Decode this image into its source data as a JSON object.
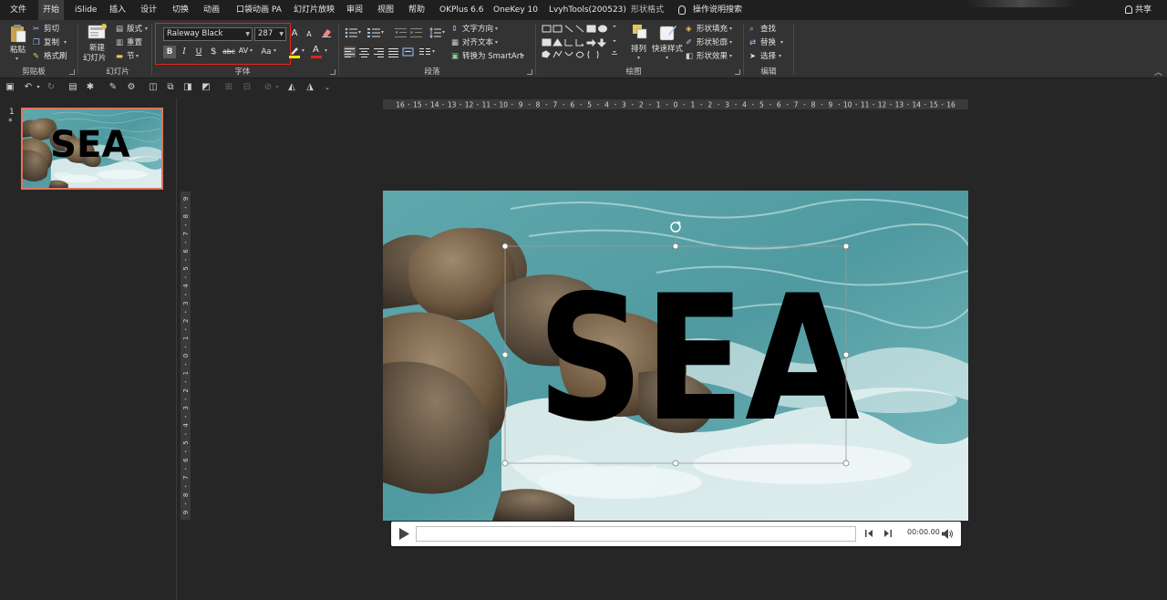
{
  "menu": {
    "tabs": [
      {
        "label": "文件"
      },
      {
        "label": "开始"
      },
      {
        "label": "iSlide"
      },
      {
        "label": "插入"
      },
      {
        "label": "设计"
      },
      {
        "label": "切换"
      },
      {
        "label": "动画"
      },
      {
        "label": "口袋动画 PA"
      },
      {
        "label": "幻灯片放映"
      },
      {
        "label": "审阅"
      },
      {
        "label": "视图"
      },
      {
        "label": "帮助"
      },
      {
        "label": "OKPlus 6.6"
      },
      {
        "label": "OneKey 10"
      },
      {
        "label": "LvyhTools(200523)"
      },
      {
        "label": "形状格式"
      }
    ],
    "active_tab": "开始",
    "search_label": "操作说明搜索",
    "share_label": "共享"
  },
  "ribbon": {
    "clipboard": {
      "paste": "粘贴",
      "cut": "剪切",
      "copy": "复制",
      "format_painter": "格式刷",
      "group_label": "剪贴板"
    },
    "slides": {
      "new_slide_line1": "新建",
      "new_slide_line2": "幻灯片",
      "layout": "版式",
      "reset": "重置",
      "section": "节",
      "group_label": "幻灯片"
    },
    "font": {
      "font_name": "Raleway Black",
      "font_size": "287",
      "bold": "B",
      "italic": "I",
      "underline": "U",
      "shadow": "S",
      "strike": "abc",
      "spacing": "AV",
      "change_case": "Aa",
      "grow": "A",
      "shrink": "A",
      "font_color": "A",
      "group_label": "字体"
    },
    "paragraph": {
      "text_direction": "文字方向",
      "align_text": "对齐文本",
      "smartart": "转换为 SmartArt",
      "group_label": "段落"
    },
    "drawing": {
      "arrange": "排列",
      "quick_styles": "快速样式",
      "shape_fill": "形状填充",
      "shape_outline": "形状轮廓",
      "shape_effects": "形状效果",
      "group_label": "绘图"
    },
    "editing": {
      "find": "查找",
      "replace": "替换",
      "select": "选择",
      "group_label": "编辑"
    }
  },
  "slides_pane": {
    "slide_number": "1",
    "star": "*",
    "thumb_text": "SEA"
  },
  "slide": {
    "title_text": "SEA"
  },
  "media": {
    "time": "00:00.00"
  },
  "ruler": {
    "horizontal_ticks": [
      "16",
      "15",
      "14",
      "13",
      "12",
      "11",
      "10",
      "9",
      "8",
      "7",
      "6",
      "5",
      "4",
      "3",
      "2",
      "1",
      "0",
      "1",
      "2",
      "3",
      "4",
      "5",
      "6",
      "7",
      "8",
      "9",
      "10",
      "11",
      "12",
      "13",
      "14",
      "15",
      "16"
    ],
    "vertical_ticks": [
      "9",
      "8",
      "7",
      "6",
      "5",
      "4",
      "3",
      "2",
      "1",
      "0",
      "1",
      "2",
      "3",
      "4",
      "5",
      "6",
      "7",
      "8",
      "9"
    ]
  },
  "colors": {
    "highlight_box": "#e2231a",
    "thumb_border": "#e0745f",
    "sea_light": "#6fb3b8",
    "sea_dark": "#2f7a82",
    "foam": "#e8f2f2",
    "rock": "#6f5a44"
  }
}
